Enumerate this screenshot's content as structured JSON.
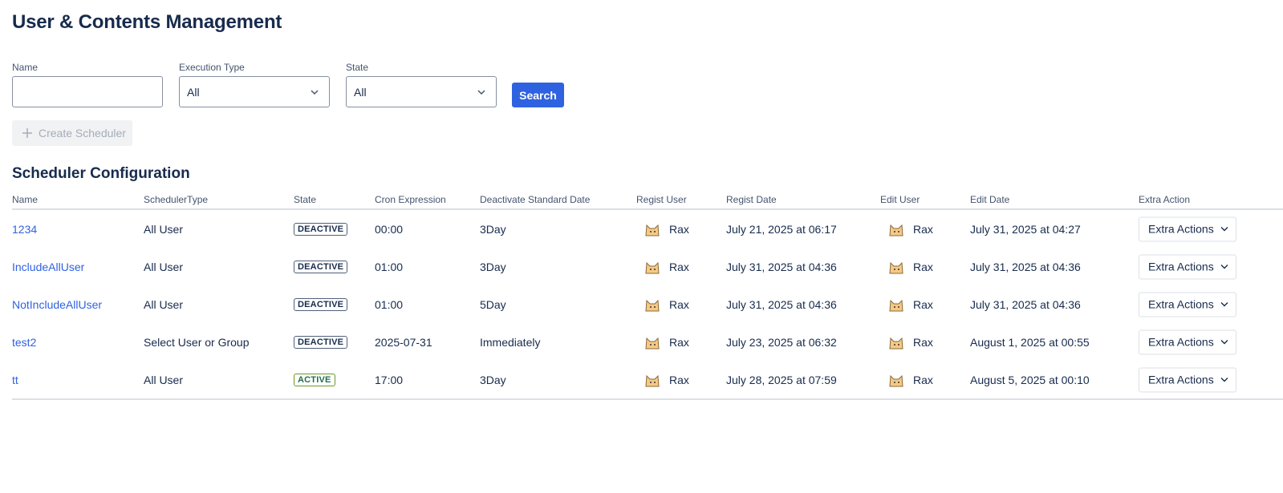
{
  "page": {
    "title": "User & Contents Management"
  },
  "filters": {
    "name_label": "Name",
    "name_value": "",
    "execution_type_label": "Execution Type",
    "execution_type_value": "All",
    "state_label": "State",
    "state_value": "All",
    "search_label": "Search"
  },
  "create_button_label": "Create Scheduler",
  "section_title": "Scheduler Configuration",
  "table": {
    "columns": [
      "Name",
      "SchedulerType",
      "State",
      "Cron Expression",
      "Deactivate Standard Date",
      "Regist User",
      "Regist Date",
      "Edit User",
      "Edit Date",
      "Extra Action"
    ],
    "rows": [
      {
        "name": "1234",
        "type": "All User",
        "state": "DEACTIVE",
        "cron": "00:00",
        "deactivate": "3Day",
        "regist_user": "Rax",
        "regist_date": "July 21, 2025 at 06:17",
        "edit_user": "Rax",
        "edit_date": "July 31, 2025 at 04:27",
        "action": "Extra Actions"
      },
      {
        "name": "IncludeAllUser",
        "type": "All User",
        "state": "DEACTIVE",
        "cron": "01:00",
        "deactivate": "3Day",
        "regist_user": "Rax",
        "regist_date": "July 31, 2025 at 04:36",
        "edit_user": "Rax",
        "edit_date": "July 31, 2025 at 04:36",
        "action": "Extra Actions"
      },
      {
        "name": "NotIncludeAllUser",
        "type": "All User",
        "state": "DEACTIVE",
        "cron": "01:00",
        "deactivate": "5Day",
        "regist_user": "Rax",
        "regist_date": "July 31, 2025 at 04:36",
        "edit_user": "Rax",
        "edit_date": "July 31, 2025 at 04:36",
        "action": "Extra Actions"
      },
      {
        "name": "test2",
        "type": "Select User or Group",
        "state": "DEACTIVE",
        "cron": "2025-07-31",
        "deactivate": "Immediately",
        "regist_user": "Rax",
        "regist_date": "July 23, 2025 at 06:32",
        "edit_user": "Rax",
        "edit_date": "August 1, 2025 at 00:55",
        "action": "Extra Actions"
      },
      {
        "name": "tt",
        "type": "All User",
        "state": "ACTIVE",
        "cron": "17:00",
        "deactivate": "3Day",
        "regist_user": "Rax",
        "regist_date": "July 28, 2025 at 07:59",
        "edit_user": "Rax",
        "edit_date": "August 5, 2025 at 00:10",
        "action": "Extra Actions"
      }
    ]
  },
  "colors": {
    "primary": "#2f62e0",
    "text": "#172b4d",
    "subtle": "#44546f",
    "active": "#6a9a23"
  },
  "icons": {
    "select_chevron": "chevron-down-icon",
    "create": "plus-icon",
    "avatar": "cat-avatar-icon"
  }
}
